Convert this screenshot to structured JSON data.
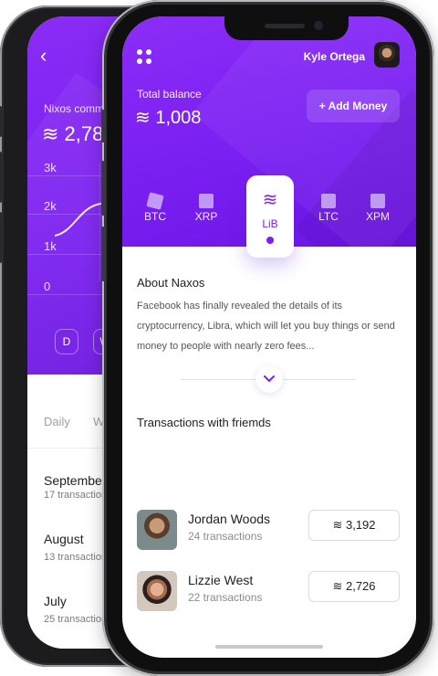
{
  "back_screen": {
    "back_arrow": "‹",
    "commission_label": "Nixos commission",
    "commission_amount": "≋ 2,786",
    "y_axis": [
      "3k",
      "2k",
      "1k",
      "0"
    ],
    "timeframe_buttons": [
      "D",
      "W"
    ],
    "tabs": [
      "Daily",
      "W"
    ],
    "months": [
      {
        "name": "September",
        "sub": "17 transactions"
      },
      {
        "name": "August",
        "sub": "13 transactions"
      },
      {
        "name": "July",
        "sub": "25 transactions"
      }
    ]
  },
  "header": {
    "user_name": "Kyle Ortega",
    "balance_label": "Total balance",
    "balance_amount": "≋ 1,008",
    "add_money_label": "+ Add Money"
  },
  "currencies": [
    {
      "label": "BTC"
    },
    {
      "label": "XRP"
    },
    {
      "label": "LiB",
      "glyph": "≋",
      "active": true
    },
    {
      "label": "LTC"
    },
    {
      "label": "XPM"
    }
  ],
  "about": {
    "title": "About Naxos",
    "text": "Facebook has finally revealed the details of its cryptocurrency, Libra, which will let you buy things or send money to people with nearly zero fees..."
  },
  "transactions": {
    "title": "Transactions with friemds",
    "items": [
      {
        "name": "Jordan Woods",
        "sub": "24 transactions",
        "amount": "≋ 3,192"
      },
      {
        "name": "Lizzie West",
        "sub": "22 transactions",
        "amount": "≋ 2,726"
      }
    ]
  },
  "colors": {
    "accent": "#7b20f3",
    "header_gradient_start": "#8c2df7",
    "header_gradient_end": "#6c15e6"
  }
}
